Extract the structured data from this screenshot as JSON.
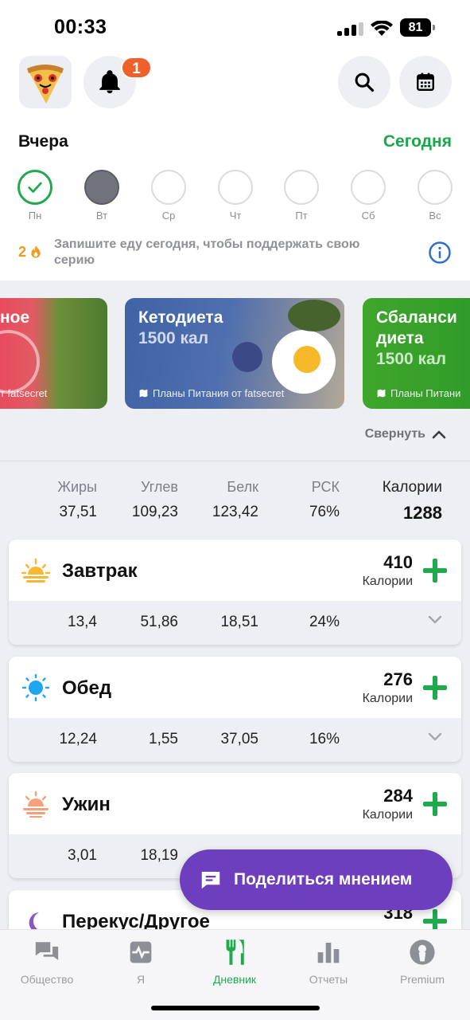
{
  "status": {
    "time": "00:33",
    "battery": "81"
  },
  "header": {
    "notification_count": "1"
  },
  "day_nav": {
    "previous_label": "Вчера",
    "today_label": "Сегодня"
  },
  "week": [
    {
      "label": "Пн",
      "state": "done"
    },
    {
      "label": "Вт",
      "state": "current"
    },
    {
      "label": "Ср",
      "state": "empty"
    },
    {
      "label": "Чт",
      "state": "empty"
    },
    {
      "label": "Пт",
      "state": "empty"
    },
    {
      "label": "Сб",
      "state": "empty"
    },
    {
      "label": "Вс",
      "state": "empty"
    }
  ],
  "streak": {
    "count": "2",
    "text": "Запишите еду сегодня, чтобы поддержать свою серию"
  },
  "promos": [
    {
      "title": "ное",
      "subtitle": "",
      "footer": "т fatsecret"
    },
    {
      "title": "Кетодиета",
      "subtitle": "1500 кал",
      "footer": "Планы Питания от fatsecret"
    },
    {
      "title": "Сбаланси",
      "title2": "диета",
      "subtitle": "1500 кал",
      "footer": "Планы Питани"
    }
  ],
  "collapse_label": "Свернуть",
  "summary": {
    "headers": {
      "fat": "Жиры",
      "carbs": "Углев",
      "protein": "Белк",
      "rsk": "РСК",
      "calories": "Калории"
    },
    "values": {
      "fat": "37,51",
      "carbs": "109,23",
      "protein": "123,42",
      "rsk": "76%",
      "calories": "1288"
    }
  },
  "meals": [
    {
      "name": "Завтрак",
      "calories": "410",
      "calories_label": "Калории",
      "fat": "13,4",
      "carbs": "51,86",
      "protein": "18,51",
      "rsk": "24%",
      "icon": "sunrise-icon"
    },
    {
      "name": "Обед",
      "calories": "276",
      "calories_label": "Калории",
      "fat": "12,24",
      "carbs": "1,55",
      "protein": "37,05",
      "rsk": "16%",
      "icon": "sun-icon"
    },
    {
      "name": "Ужин",
      "calories": "284",
      "calories_label": "Калории",
      "fat": "3,01",
      "carbs": "18,19",
      "protein": "",
      "rsk": "",
      "icon": "sunset-icon"
    },
    {
      "name": "Перекус/Другое",
      "calories": "318",
      "calories_label": "",
      "icon": "moon-icon"
    }
  ],
  "feedback_button": "Поделиться мнением",
  "tabs": [
    {
      "label": "Общество",
      "icon": "chat-icon"
    },
    {
      "label": "Я",
      "icon": "heart-pulse-icon"
    },
    {
      "label": "Дневник",
      "icon": "fork-knife-icon",
      "active": true
    },
    {
      "label": "Отчеты",
      "icon": "bar-chart-icon"
    },
    {
      "label": "Premium",
      "icon": "premium-icon"
    }
  ],
  "colors": {
    "accent_green": "#1faa4d",
    "streak_orange": "#f09a1e",
    "badge_orange": "#f0602a",
    "fab_purple": "#6d3fbf"
  }
}
